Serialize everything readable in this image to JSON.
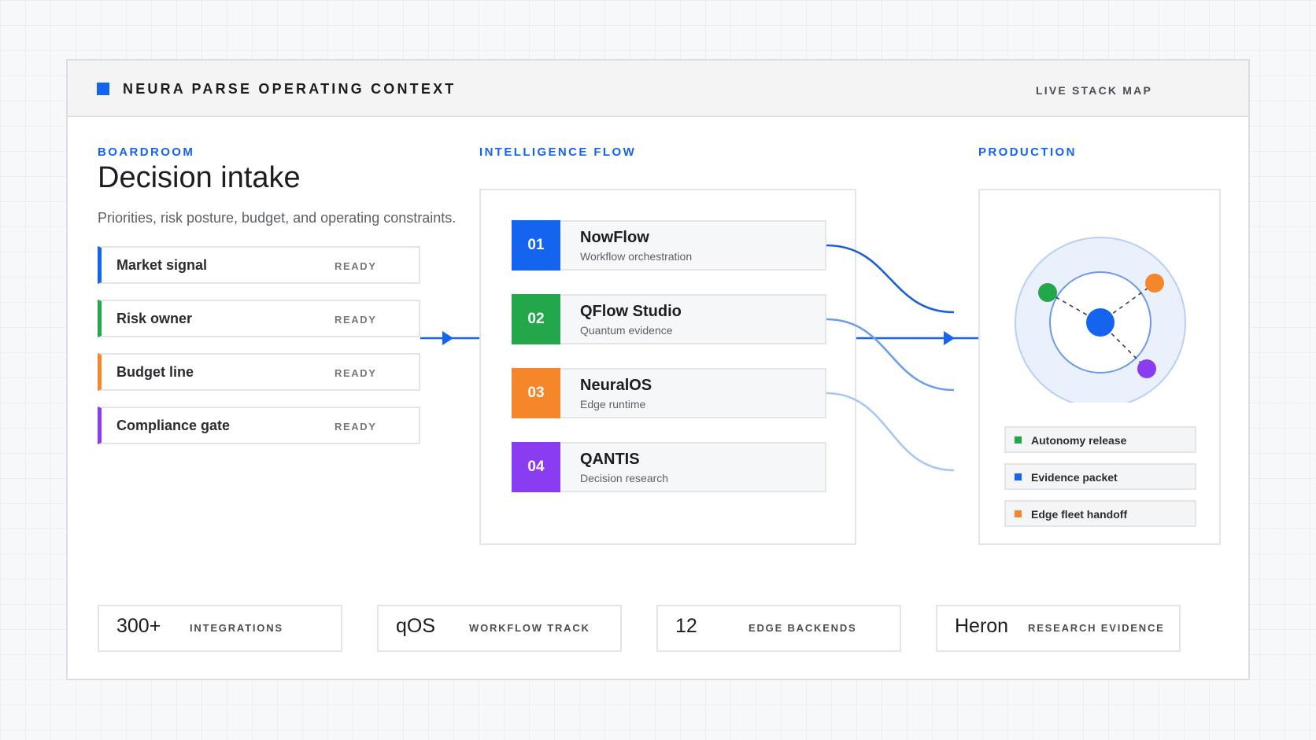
{
  "header": {
    "title": "NEURA PARSE OPERATING CONTEXT",
    "right_label": "LIVE STACK MAP"
  },
  "boardroom": {
    "section_label": "BOARDROOM",
    "title": "Decision intake",
    "subtitle": "Priorities, risk posture, budget, and operating constraints.",
    "items": [
      {
        "label": "Market signal",
        "status": "READY",
        "color": "#1464f0"
      },
      {
        "label": "Risk owner",
        "status": "READY",
        "color": "#22a84a"
      },
      {
        "label": "Budget line",
        "status": "READY",
        "color": "#f5862a"
      },
      {
        "label": "Compliance gate",
        "status": "READY",
        "color": "#8a3cf0"
      }
    ]
  },
  "intelligence_flow": {
    "section_label": "INTELLIGENCE FLOW",
    "items": [
      {
        "number": "01",
        "name": "NowFlow",
        "description": "Workflow orchestration",
        "color": "#1464f0"
      },
      {
        "number": "02",
        "name": "QFlow Studio",
        "description": "Quantum evidence",
        "color": "#22a84a"
      },
      {
        "number": "03",
        "name": "NeuralOS",
        "description": "Edge runtime",
        "color": "#f5862a"
      },
      {
        "number": "04",
        "name": "QANTIS",
        "description": "Decision research",
        "color": "#8a3cf0"
      }
    ]
  },
  "production": {
    "section_label": "PRODUCTION",
    "legend": [
      {
        "label": "Autonomy release",
        "color": "#22a84a"
      },
      {
        "label": "Evidence packet",
        "color": "#1464f0"
      },
      {
        "label": "Edge fleet handoff",
        "color": "#f5862a"
      }
    ]
  },
  "stats": [
    {
      "value": "300+",
      "label": "INTEGRATIONS"
    },
    {
      "value": "qOS",
      "label": "WORKFLOW TRACK"
    },
    {
      "value": "12",
      "label": "EDGE BACKENDS"
    },
    {
      "value": "Heron",
      "label": "RESEARCH EVIDENCE"
    }
  ],
  "colors": {
    "accent": "#1464f0",
    "green": "#22a84a",
    "orange": "#f5862a",
    "purple": "#8a3cf0"
  }
}
